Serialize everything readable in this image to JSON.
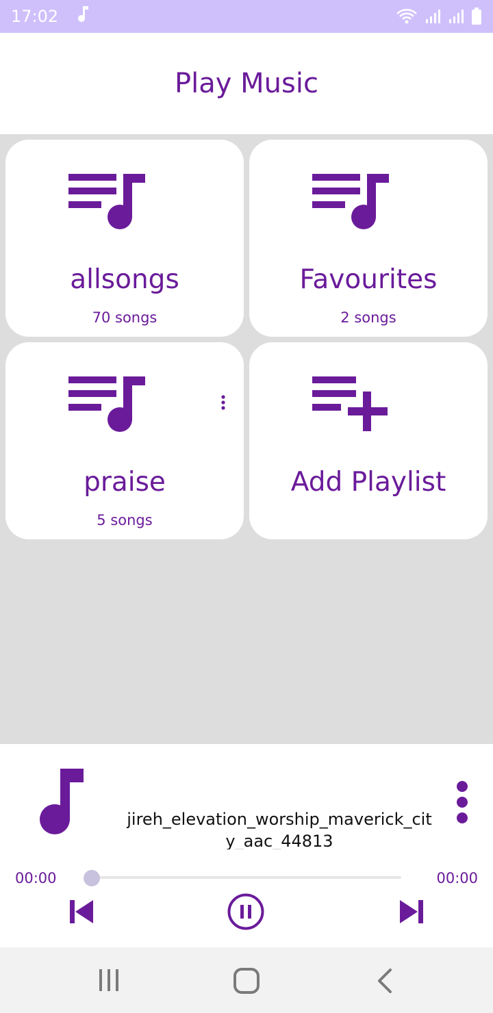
{
  "status_bar": {
    "time": "17:02",
    "icons": [
      "music-note-icon",
      "wifi-icon",
      "signal-icon",
      "signal-icon",
      "battery-icon"
    ]
  },
  "header": {
    "title": "Play Music"
  },
  "playlists": [
    {
      "title": "allsongs",
      "subtitle": "70 songs",
      "icon": "playlist-music-icon"
    },
    {
      "title": "Favourites",
      "subtitle": "2 songs",
      "icon": "playlist-music-icon"
    },
    {
      "title": "praise",
      "subtitle": "5 songs",
      "icon": "playlist-music-icon",
      "has_menu": true
    },
    {
      "title": "Add Playlist",
      "subtitle": "",
      "icon": "playlist-add-icon"
    }
  ],
  "player": {
    "track_title": "jireh_elevation_worship_maverick_city_aac_44813",
    "elapsed": "00:00",
    "duration": "00:00",
    "progress": 0,
    "state": "playing"
  },
  "nav": {
    "icons": [
      "recents-icon",
      "home-icon",
      "back-icon"
    ]
  },
  "colors": {
    "accent": "#6a1b9a",
    "status_bar": "#cfc0fc",
    "grid_background": "#dddddd",
    "seek_thumb": "#c9c2de"
  }
}
